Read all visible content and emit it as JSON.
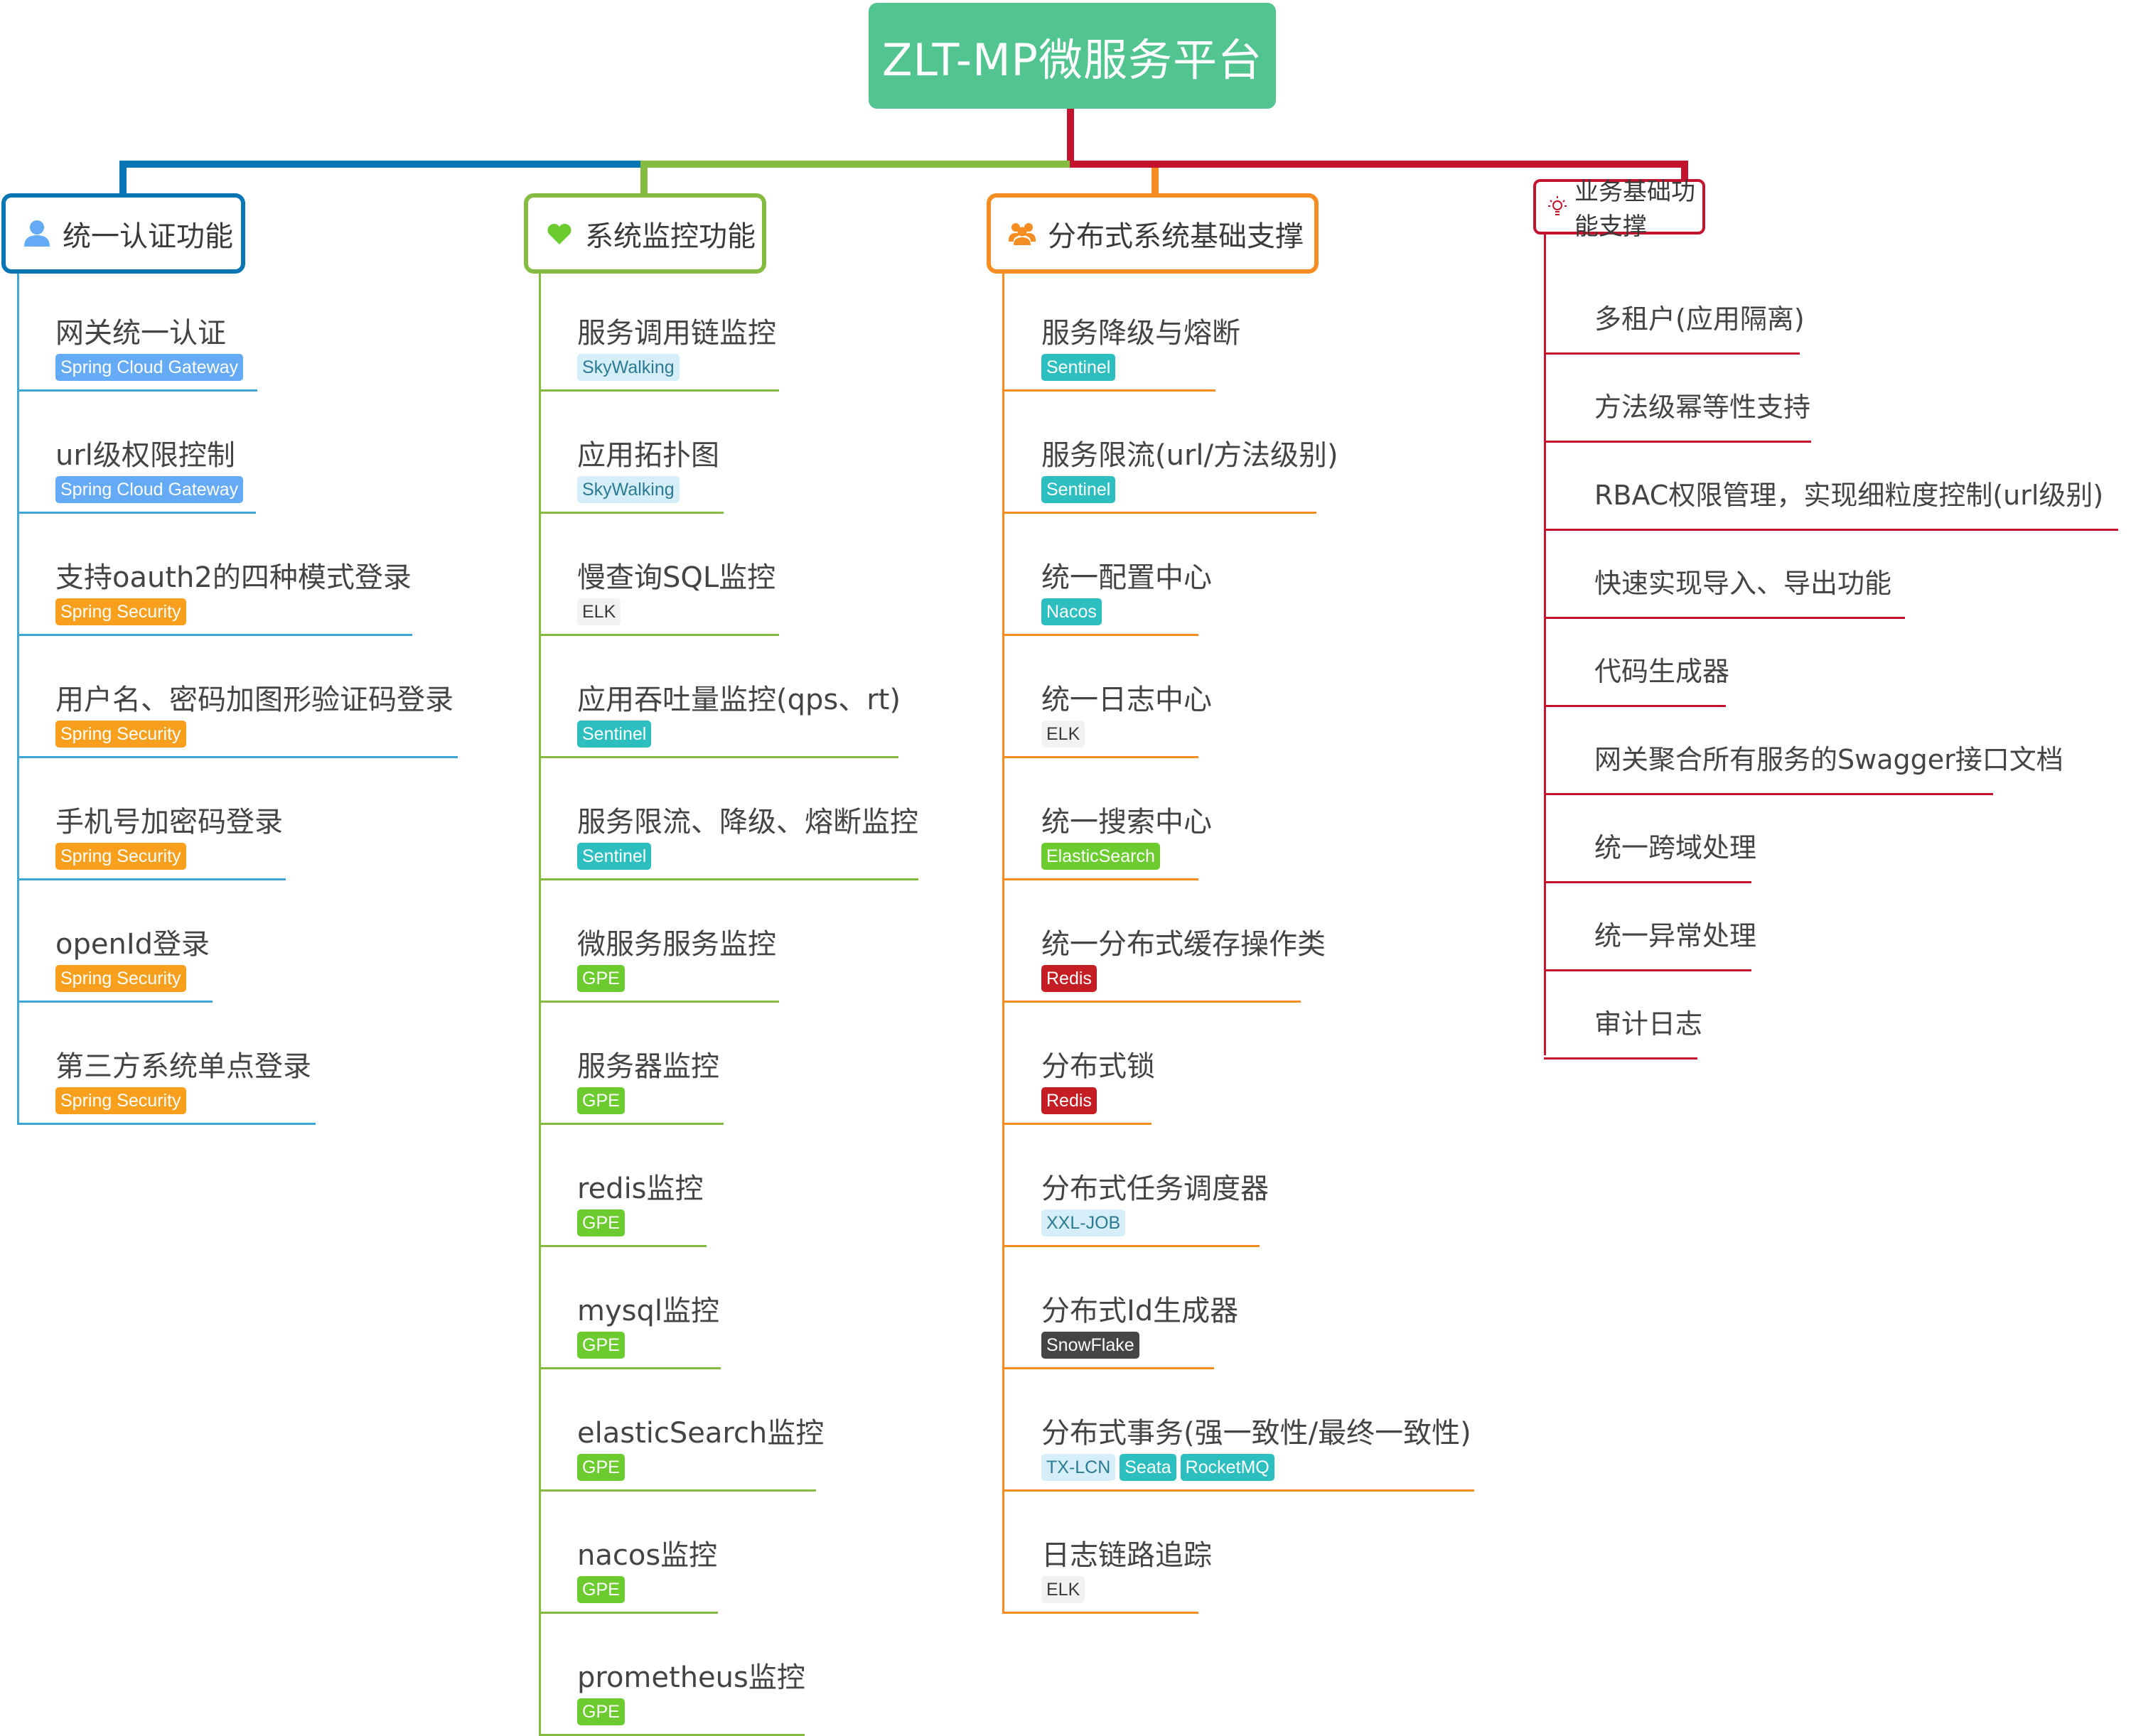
{
  "root": {
    "title": "ZLT-MP微服务平台",
    "color": "#52c48f"
  },
  "tag_styles": {
    "gateway": {
      "bg": "#64aaf5",
      "fg": "#ffffff"
    },
    "security": {
      "bg": "#f8a01e",
      "fg": "#ffffff"
    },
    "sky": {
      "bg": "#d6eef7",
      "fg": "#2b7b93"
    },
    "elk": {
      "bg": "#f2f2f2",
      "fg": "#3a3a3a"
    },
    "teal": {
      "bg": "#2dbfbf",
      "fg": "#ffffff"
    },
    "green": {
      "bg": "#6ccb2f",
      "fg": "#ffffff"
    },
    "redis": {
      "bg": "#c41e24",
      "fg": "#ffffff"
    },
    "dark": {
      "bg": "#454545",
      "fg": "#ffffff"
    }
  },
  "categories": [
    {
      "title": "统一认证功能",
      "icon": "user-icon",
      "color": "#0a75b4",
      "line_color": "#3ea7d6",
      "items": [
        {
          "label": "网关统一认证",
          "tags": [
            {
              "text": "Spring Cloud Gateway",
              "style": "gateway"
            }
          ]
        },
        {
          "label": "url级权限控制",
          "tags": [
            {
              "text": "Spring Cloud Gateway",
              "style": "gateway"
            }
          ]
        },
        {
          "label": "支持oauth2的四种模式登录",
          "tags": [
            {
              "text": "Spring Security",
              "style": "security"
            }
          ]
        },
        {
          "label": "用户名、密码加图形验证码登录",
          "tags": [
            {
              "text": "Spring Security",
              "style": "security"
            }
          ]
        },
        {
          "label": "手机号加密码登录",
          "tags": [
            {
              "text": "Spring Security",
              "style": "security"
            }
          ]
        },
        {
          "label": "openId登录",
          "tags": [
            {
              "text": "Spring Security",
              "style": "security"
            }
          ]
        },
        {
          "label": "第三方系统单点登录",
          "tags": [
            {
              "text": "Spring Security",
              "style": "security"
            }
          ]
        }
      ]
    },
    {
      "title": "系统监控功能",
      "icon": "heart-icon",
      "color": "#84bb40",
      "line_color": "#84bb40",
      "items": [
        {
          "label": "服务调用链监控",
          "tags": [
            {
              "text": "SkyWalking",
              "style": "sky"
            }
          ]
        },
        {
          "label": "应用拓扑图",
          "tags": [
            {
              "text": "SkyWalking",
              "style": "sky"
            }
          ]
        },
        {
          "label": "慢查询SQL监控",
          "tags": [
            {
              "text": "ELK",
              "style": "elk"
            }
          ]
        },
        {
          "label": "应用吞吐量监控(qps、rt)",
          "tags": [
            {
              "text": "Sentinel",
              "style": "teal"
            }
          ]
        },
        {
          "label": "服务限流、降级、熔断监控",
          "tags": [
            {
              "text": "Sentinel",
              "style": "teal"
            }
          ]
        },
        {
          "label": "微服务服务监控",
          "tags": [
            {
              "text": "GPE",
              "style": "green"
            }
          ]
        },
        {
          "label": "服务器监控",
          "tags": [
            {
              "text": "GPE",
              "style": "green"
            }
          ]
        },
        {
          "label": "redis监控",
          "tags": [
            {
              "text": "GPE",
              "style": "green"
            }
          ]
        },
        {
          "label": "mysql监控",
          "tags": [
            {
              "text": "GPE",
              "style": "green"
            }
          ]
        },
        {
          "label": "elasticSearch监控",
          "tags": [
            {
              "text": "GPE",
              "style": "green"
            }
          ]
        },
        {
          "label": "nacos监控",
          "tags": [
            {
              "text": "GPE",
              "style": "green"
            }
          ]
        },
        {
          "label": "prometheus监控",
          "tags": [
            {
              "text": "GPE",
              "style": "green"
            }
          ]
        }
      ]
    },
    {
      "title": "分布式系统基础支撑",
      "icon": "group-icon",
      "color": "#f58d22",
      "line_color": "#f58d22",
      "items": [
        {
          "label": "服务降级与熔断",
          "tags": [
            {
              "text": "Sentinel",
              "style": "teal"
            }
          ]
        },
        {
          "label": "服务限流(url/方法级别)",
          "tags": [
            {
              "text": "Sentinel",
              "style": "teal"
            }
          ]
        },
        {
          "label": "统一配置中心",
          "tags": [
            {
              "text": "Nacos",
              "style": "teal"
            }
          ]
        },
        {
          "label": "统一日志中心",
          "tags": [
            {
              "text": "ELK",
              "style": "elk"
            }
          ]
        },
        {
          "label": "统一搜索中心",
          "tags": [
            {
              "text": "ElasticSearch",
              "style": "green"
            }
          ]
        },
        {
          "label": "统一分布式缓存操作类",
          "tags": [
            {
              "text": "Redis",
              "style": "redis"
            }
          ]
        },
        {
          "label": "分布式锁",
          "tags": [
            {
              "text": "Redis",
              "style": "redis"
            }
          ]
        },
        {
          "label": "分布式任务调度器",
          "tags": [
            {
              "text": "XXL-JOB",
              "style": "sky"
            }
          ]
        },
        {
          "label": "分布式Id生成器",
          "tags": [
            {
              "text": "SnowFlake",
              "style": "dark"
            }
          ]
        },
        {
          "label": "分布式事务(强一致性/最终一致性)",
          "tags": [
            {
              "text": "TX-LCN",
              "style": "sky"
            },
            {
              "text": "Seata",
              "style": "teal"
            },
            {
              "text": "RocketMQ",
              "style": "teal"
            }
          ]
        },
        {
          "label": "日志链路追踪",
          "tags": [
            {
              "text": "ELK",
              "style": "elk"
            }
          ]
        }
      ]
    },
    {
      "title": "业务基础功能支撑",
      "icon": "lightbulb-icon",
      "color": "#c4132f",
      "line_color": "#c4132f",
      "items": [
        {
          "label": "多租户(应用隔离)",
          "tags": []
        },
        {
          "label": "方法级幂等性支持",
          "tags": []
        },
        {
          "label": "RBAC权限管理，实现细粒度控制(url级别)",
          "tags": []
        },
        {
          "label": "快速实现导入、导出功能",
          "tags": []
        },
        {
          "label": "代码生成器",
          "tags": []
        },
        {
          "label": "网关聚合所有服务的Swagger接口文档",
          "tags": []
        },
        {
          "label": "统一跨域处理",
          "tags": []
        },
        {
          "label": "统一异常处理",
          "tags": []
        },
        {
          "label": "审计日志",
          "tags": []
        }
      ]
    }
  ]
}
